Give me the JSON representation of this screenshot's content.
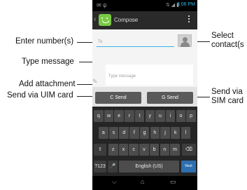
{
  "status_bar": {
    "left_icons": "✉ ψ",
    "right_icons": "⇅ ◢ ▮",
    "time": "3:06 PM"
  },
  "action_bar": {
    "title": "Compose",
    "icon": "app-icon"
  },
  "compose": {
    "to_placeholder": "To",
    "message_placeholder": "Type message"
  },
  "send": {
    "c_label": "C Send",
    "g_label": "G Send"
  },
  "keyboard": {
    "row1": [
      "q",
      "w",
      "e",
      "r",
      "t",
      "y",
      "u",
      "i",
      "o",
      "p"
    ],
    "row2": [
      "a",
      "s",
      "d",
      "f",
      "g",
      "h",
      "j",
      "k",
      "l"
    ],
    "row3": [
      "z",
      "x",
      "c",
      "v",
      "b",
      "n",
      "m"
    ],
    "shift": "⇧",
    "delete": "⌫",
    "sym": "?123",
    "mic": "🎤",
    "space": "English (US)",
    "next": "Next"
  },
  "nav": {
    "back": "⌵",
    "home": "⌂",
    "recent": "▭"
  },
  "callouts": {
    "enter_numbers": "Enter number(s)",
    "type_message": "Type message",
    "add_attachment": "Add attachment",
    "send_uim": "Send via UIM card",
    "select_contacts_1": "Select",
    "select_contacts_2": "contact(s",
    "send_sim_1": "Send via",
    "send_sim_2": "SIM card"
  }
}
